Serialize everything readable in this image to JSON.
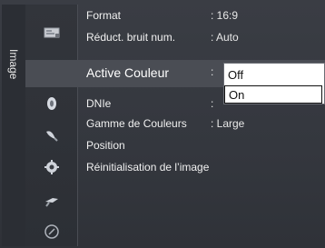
{
  "osd": {
    "section_label": "Image",
    "items": [
      {
        "label": "Format",
        "value": ": 16:9"
      },
      {
        "label": "Réduct. bruit num.",
        "value": ": Auto"
      },
      {
        "label": "Active Couleur",
        "value": ":"
      },
      {
        "label": "DNIe",
        "value": ":"
      },
      {
        "label": "Gamme de Couleurs",
        "value": ": Large"
      },
      {
        "label": "Position",
        "value": ""
      },
      {
        "label": "Réinitialisation de l’image",
        "value": ""
      }
    ],
    "dropdown": {
      "options": [
        "Off",
        "On"
      ],
      "selected": "On"
    },
    "icons": [
      "picture-icon",
      "screen-icon",
      "sound-icon",
      "satellite-dish-icon",
      "gear-icon",
      "input-plug-icon",
      "support-circle-icon"
    ]
  }
}
